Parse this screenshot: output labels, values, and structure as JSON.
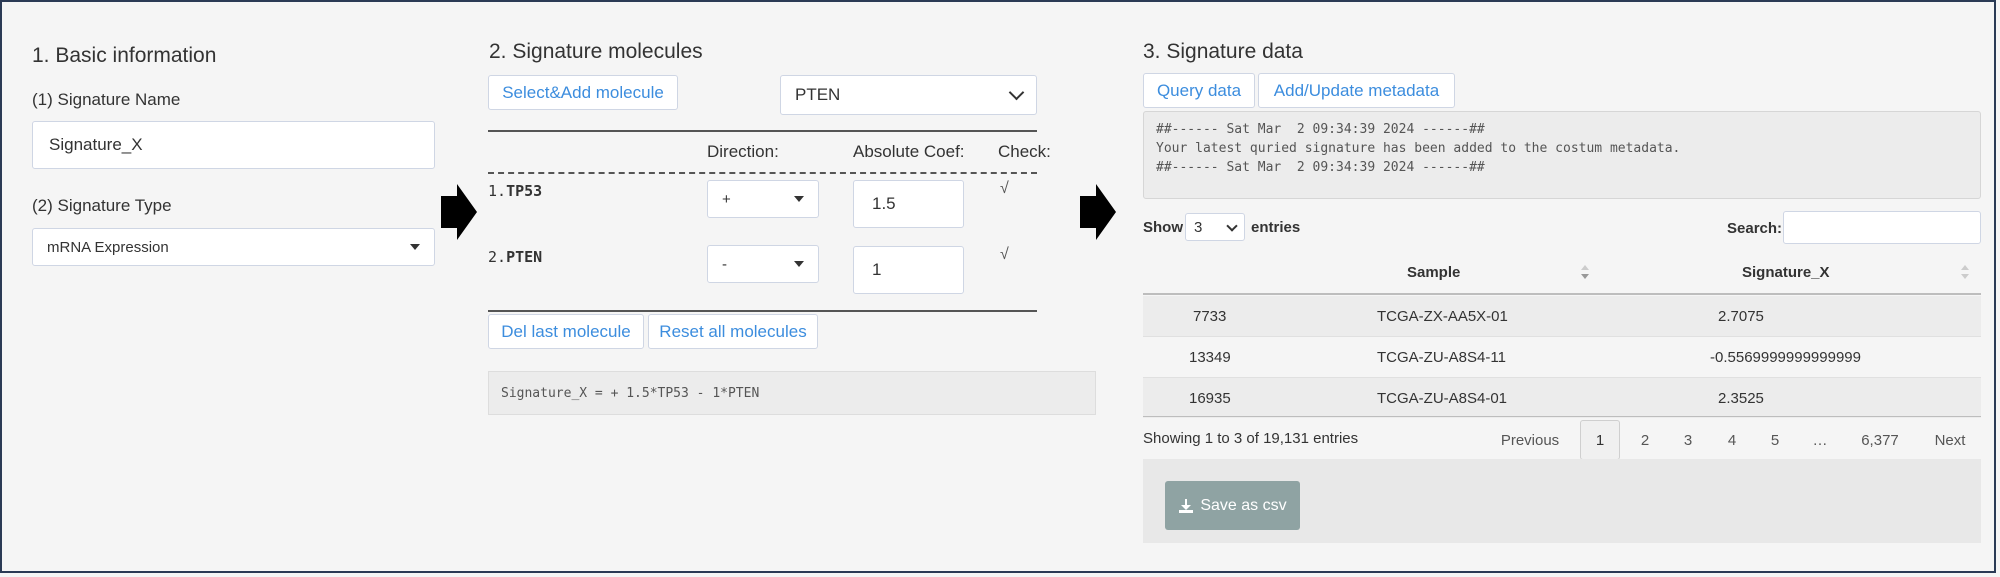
{
  "section1": {
    "title": "1. Basic information",
    "name_label": "(1) Signature Name",
    "name_value": "Signature_X",
    "type_label": "(2) Signature Type",
    "type_value": "mRNA Expression"
  },
  "section2": {
    "title": "2. Signature molecules",
    "select_add_label": "Select&Add molecule",
    "molecule_select_value": "PTEN",
    "headers": {
      "direction": "Direction:",
      "coef": "Absolute Coef:",
      "check": "Check:"
    },
    "molecules": [
      {
        "index": "1.",
        "name": "TP53",
        "direction": "+",
        "coef": "1.5",
        "check": "√"
      },
      {
        "index": "2.",
        "name": "PTEN",
        "direction": "-",
        "coef": "1",
        "check": "√"
      }
    ],
    "del_last_label": "Del last molecule",
    "reset_all_label": "Reset all molecules",
    "formula": "Signature_X = + 1.5*TP53 - 1*PTEN"
  },
  "section3": {
    "title": "3. Signature data",
    "query_label": "Query data",
    "metadata_label": "Add/Update metadata",
    "log": [
      "##------ Sat Mar  2 09:34:39 2024 ------##",
      "Your latest quried signature has been added to the costum metadata.",
      "##------ Sat Mar  2 09:34:39 2024 ------##"
    ],
    "show_label": "Show",
    "show_value": "3",
    "entries_label": "entries",
    "search_label": "Search:",
    "search_value": "",
    "columns": [
      "Sample",
      "Signature_X"
    ],
    "rows": [
      {
        "id": "7733",
        "sample": "TCGA-ZX-AA5X-01",
        "value": "2.7075"
      },
      {
        "id": "13349",
        "sample": "TCGA-ZU-A8S4-11",
        "value": "-0.5569999999999999"
      },
      {
        "id": "16935",
        "sample": "TCGA-ZU-A8S4-01",
        "value": "2.3525"
      }
    ],
    "info": "Showing 1 to 3 of 19,131 entries",
    "pagination": {
      "previous": "Previous",
      "pages": [
        "1",
        "2",
        "3",
        "4",
        "5",
        "…",
        "6,377"
      ],
      "next": "Next"
    },
    "save_label": "Save as csv"
  }
}
